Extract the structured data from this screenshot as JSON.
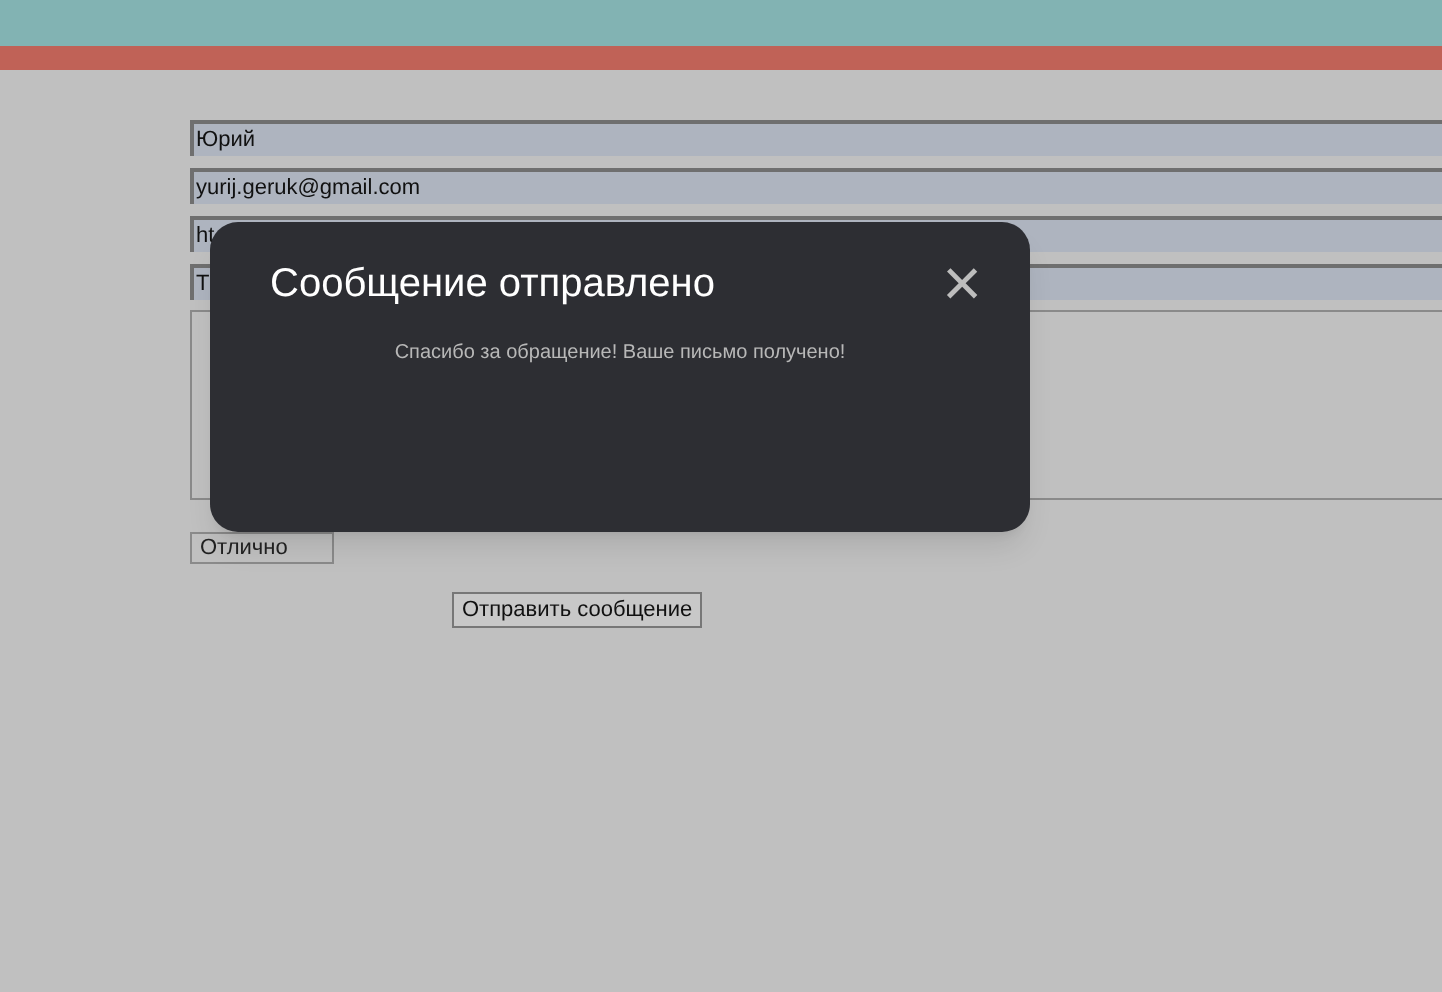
{
  "form": {
    "fields": [
      {
        "value": "Юрий"
      },
      {
        "value": "yurij.geruk@gmail.com"
      },
      {
        "value": "ht"
      },
      {
        "value": "Т"
      }
    ],
    "select": {
      "value": "Отлично"
    },
    "submit_button": "Отправить сообщение"
  },
  "dialog": {
    "title": "Сообщение отправлено",
    "close": "×",
    "message": "Спасибо за обращение! Ваше письмо получено!"
  }
}
